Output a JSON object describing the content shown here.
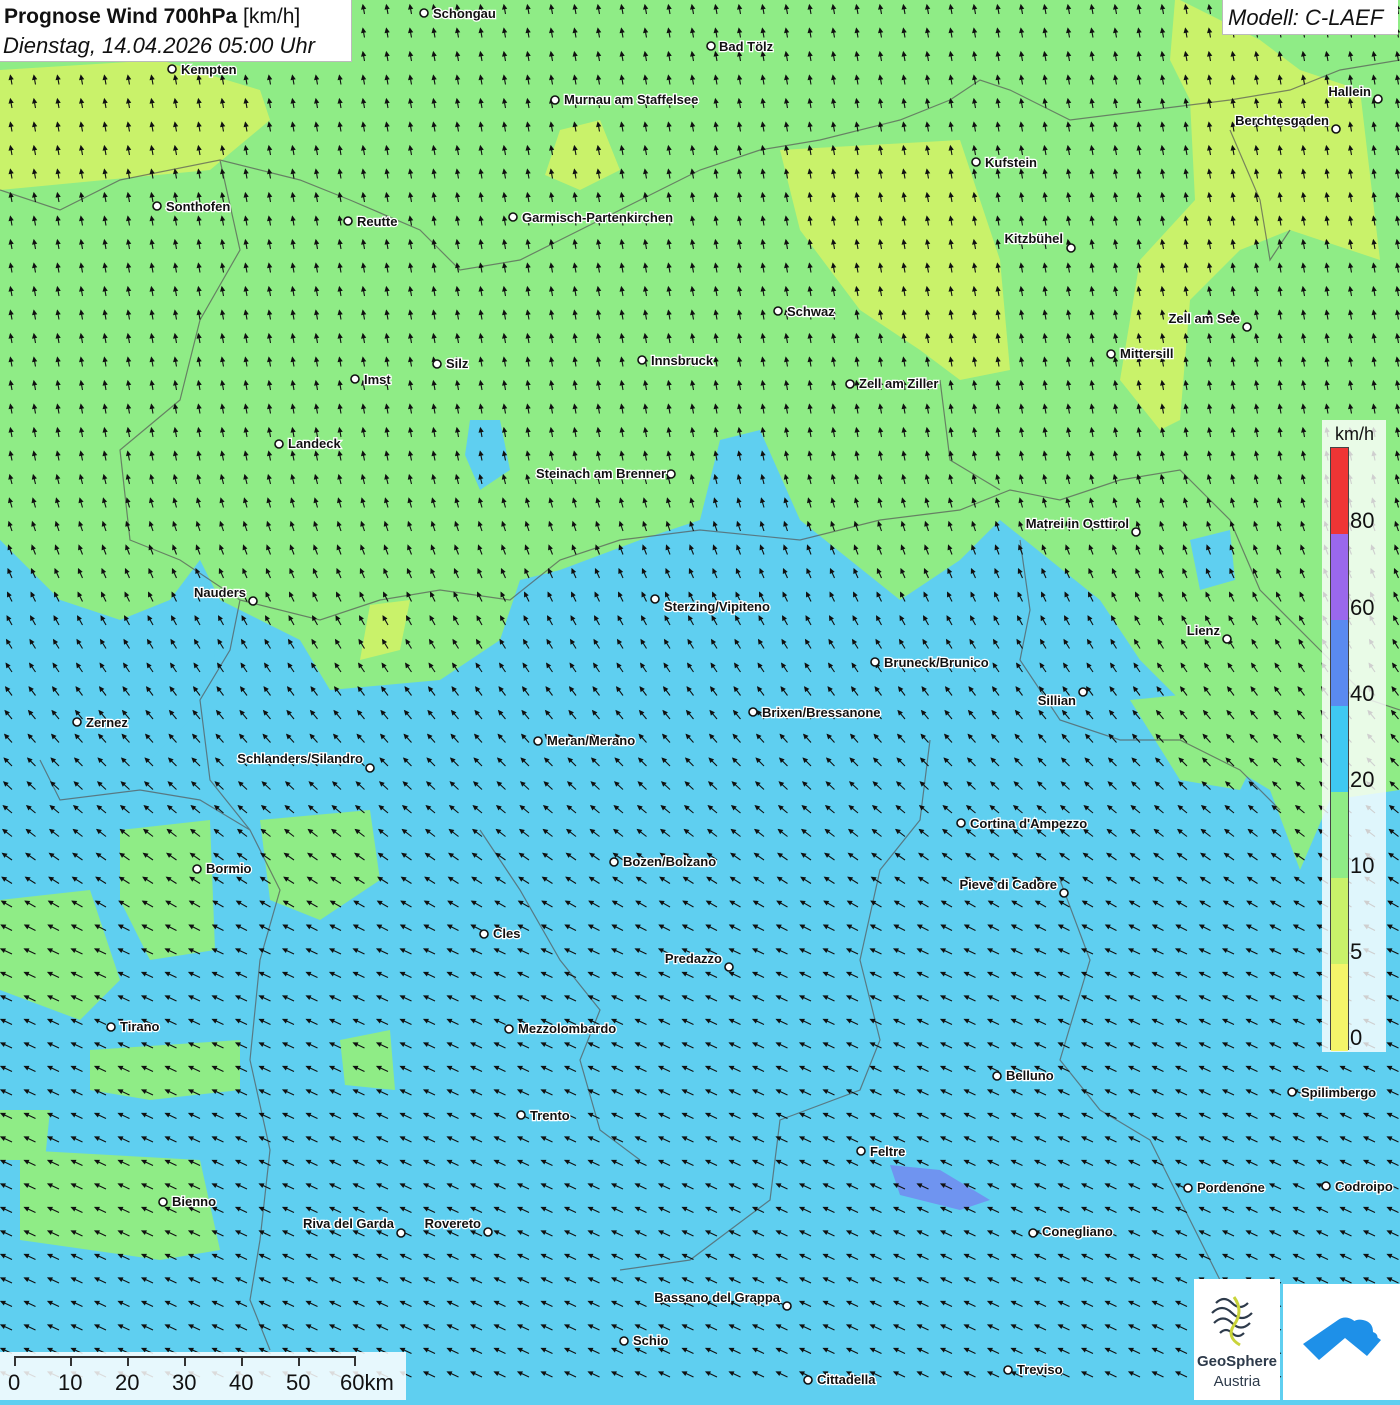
{
  "header": {
    "title_bold": "Prognose Wind 700hPa",
    "title_unit": "[km/h]",
    "datetime": "Dienstag, 14.04.2026 05:00 Uhr"
  },
  "model": {
    "label": "Modell: C-LAEF"
  },
  "legend": {
    "unit": "km/h",
    "classes": [
      {
        "min": 0,
        "max": 5,
        "color": "#f5f56a"
      },
      {
        "min": 5,
        "max": 10,
        "color": "#c9f26a"
      },
      {
        "min": 10,
        "max": 20,
        "color": "#8fec86"
      },
      {
        "min": 20,
        "max": 40,
        "color": "#3fc9f2"
      },
      {
        "min": 40,
        "max": 60,
        "color": "#5a8af0"
      },
      {
        "min": 60,
        "max": 80,
        "color": "#9a68ec"
      },
      {
        "min": 80,
        "max": 100,
        "color": "#ef3535"
      }
    ],
    "labels": [
      "80",
      "60",
      "40",
      "20",
      "10",
      "5",
      "0"
    ]
  },
  "scalebar": {
    "labels": [
      "0",
      "10",
      "20",
      "30",
      "40",
      "50",
      "60km"
    ]
  },
  "logos": {
    "geosphere_line1": "GeoSphere",
    "geosphere_line2": "Austria"
  },
  "cities": [
    "Schongau",
    "Bad Tölz",
    "Kempten",
    "Murnau am Staffelsee",
    "Hallein",
    "Berchtesgaden",
    "Kufstein",
    "Sonthofen",
    "Reutte",
    "Garmisch-Partenkirchen",
    "Kitzbühel",
    "Schwaz",
    "Zell am See",
    "Mittersill",
    "Silz",
    "Innsbruck",
    "Imst",
    "Zell am Ziller",
    "Landeck",
    "Steinach am Brenner",
    "Matrei in Osttirol",
    "Nauders",
    "Sterzing/Vipiteno",
    "Lienz",
    "Bruneck/Brunico",
    "Sillian",
    "Zernez",
    "Brixen/Bressanone",
    "Meran/Merano",
    "Schlanders/Silandro",
    "Cortina d'Ampezzo",
    "Bozen/Bolzano",
    "Bormio",
    "Pieve di Cadore",
    "Cles",
    "Predazzo",
    "Tirano",
    "Mezzolombardo",
    "Belluno",
    "Spilimbergo",
    "Trento",
    "Feltre",
    "Pordenone",
    "Codroipo",
    "Bienno",
    "Riva del Garda",
    "Rovereto",
    "Conegliano",
    "Bassano del Grappa",
    "Schio",
    "Treviso",
    "Cittadella"
  ],
  "wind_field": {
    "direction": "from south-east in the south, from south in the north",
    "speed_range_kmh": [
      5,
      45
    ]
  }
}
